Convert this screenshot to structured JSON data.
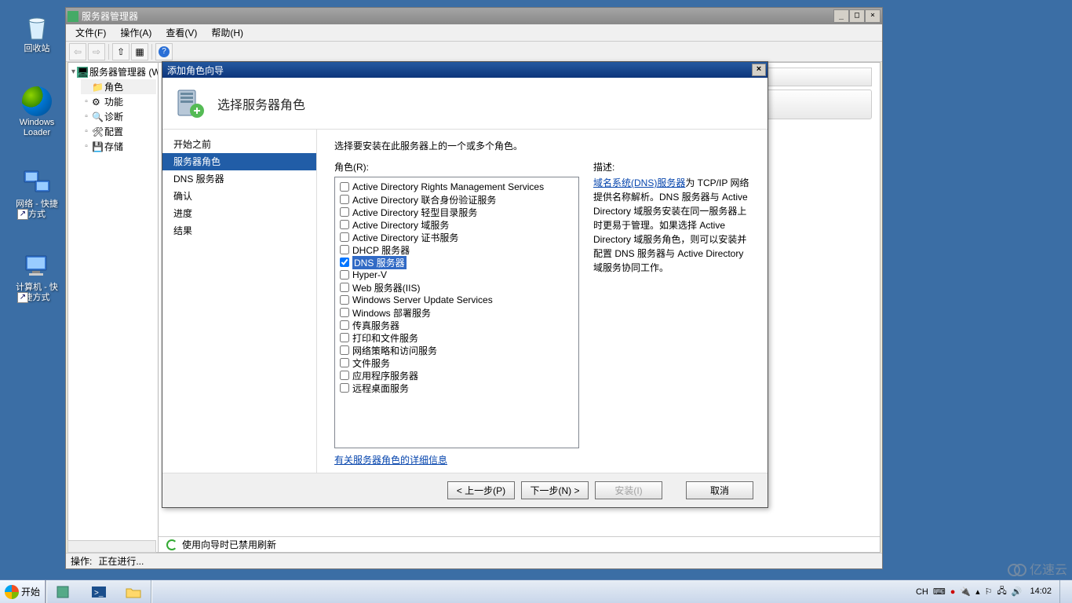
{
  "desktop": {
    "recycle": "回收站",
    "loader": "Windows\nLoader",
    "net": "网络 - 快捷\n方式",
    "comp": "计算机 - 快\n捷方式"
  },
  "server_manager": {
    "title": "服务器管理器",
    "menu": {
      "file": "文件(F)",
      "action": "操作(A)",
      "view": "查看(V)",
      "help": "帮助(H)"
    },
    "tree": {
      "root": "服务器管理器 (W",
      "roles": "角色",
      "features": "功能",
      "diag": "诊断",
      "config": "配置",
      "storage": "存储"
    },
    "refresh": "使用向导时已禁用刷新",
    "status_label": "操作:",
    "status_value": "正在进行..."
  },
  "wizard": {
    "title": "添加角色向导",
    "header": "选择服务器角色",
    "nav": {
      "before": "开始之前",
      "server_roles": "服务器角色",
      "dns": "DNS 服务器",
      "confirm": "确认",
      "progress": "进度",
      "result": "结果"
    },
    "instruction": "选择要安装在此服务器上的一个或多个角色。",
    "roles_label": "角色(R):",
    "roles": [
      {
        "label": "Active Directory Rights Management Services",
        "checked": false
      },
      {
        "label": "Active Directory 联合身份验证服务",
        "checked": false
      },
      {
        "label": "Active Directory 轻型目录服务",
        "checked": false
      },
      {
        "label": "Active Directory 域服务",
        "checked": false
      },
      {
        "label": "Active Directory 证书服务",
        "checked": false
      },
      {
        "label": "DHCP 服务器",
        "checked": false
      },
      {
        "label": "DNS 服务器",
        "checked": true,
        "selected": true
      },
      {
        "label": "Hyper-V",
        "checked": false
      },
      {
        "label": "Web 服务器(IIS)",
        "checked": false
      },
      {
        "label": "Windows Server Update Services",
        "checked": false
      },
      {
        "label": "Windows 部署服务",
        "checked": false
      },
      {
        "label": "传真服务器",
        "checked": false
      },
      {
        "label": "打印和文件服务",
        "checked": false
      },
      {
        "label": "网络策略和访问服务",
        "checked": false
      },
      {
        "label": "文件服务",
        "checked": false
      },
      {
        "label": "应用程序服务器",
        "checked": false
      },
      {
        "label": "远程桌面服务",
        "checked": false
      }
    ],
    "desc_label": "描述:",
    "desc_link": "域名系统(DNS)服务器",
    "desc_text": "为 TCP/IP 网络提供名称解析。DNS 服务器与 Active Directory 域服务安装在同一服务器上时更易于管理。如果选择 Active Directory 域服务角色，则可以安装并配置 DNS 服务器与 Active Directory 域服务协同工作。",
    "more_link": "有关服务器角色的详细信息",
    "btn_prev": "< 上一步(P)",
    "btn_next": "下一步(N) >",
    "btn_install": "安装(I)",
    "btn_cancel": "取消"
  },
  "taskbar": {
    "start": "开始",
    "lang": "CH",
    "time": "14:02"
  },
  "watermark": "亿速云"
}
